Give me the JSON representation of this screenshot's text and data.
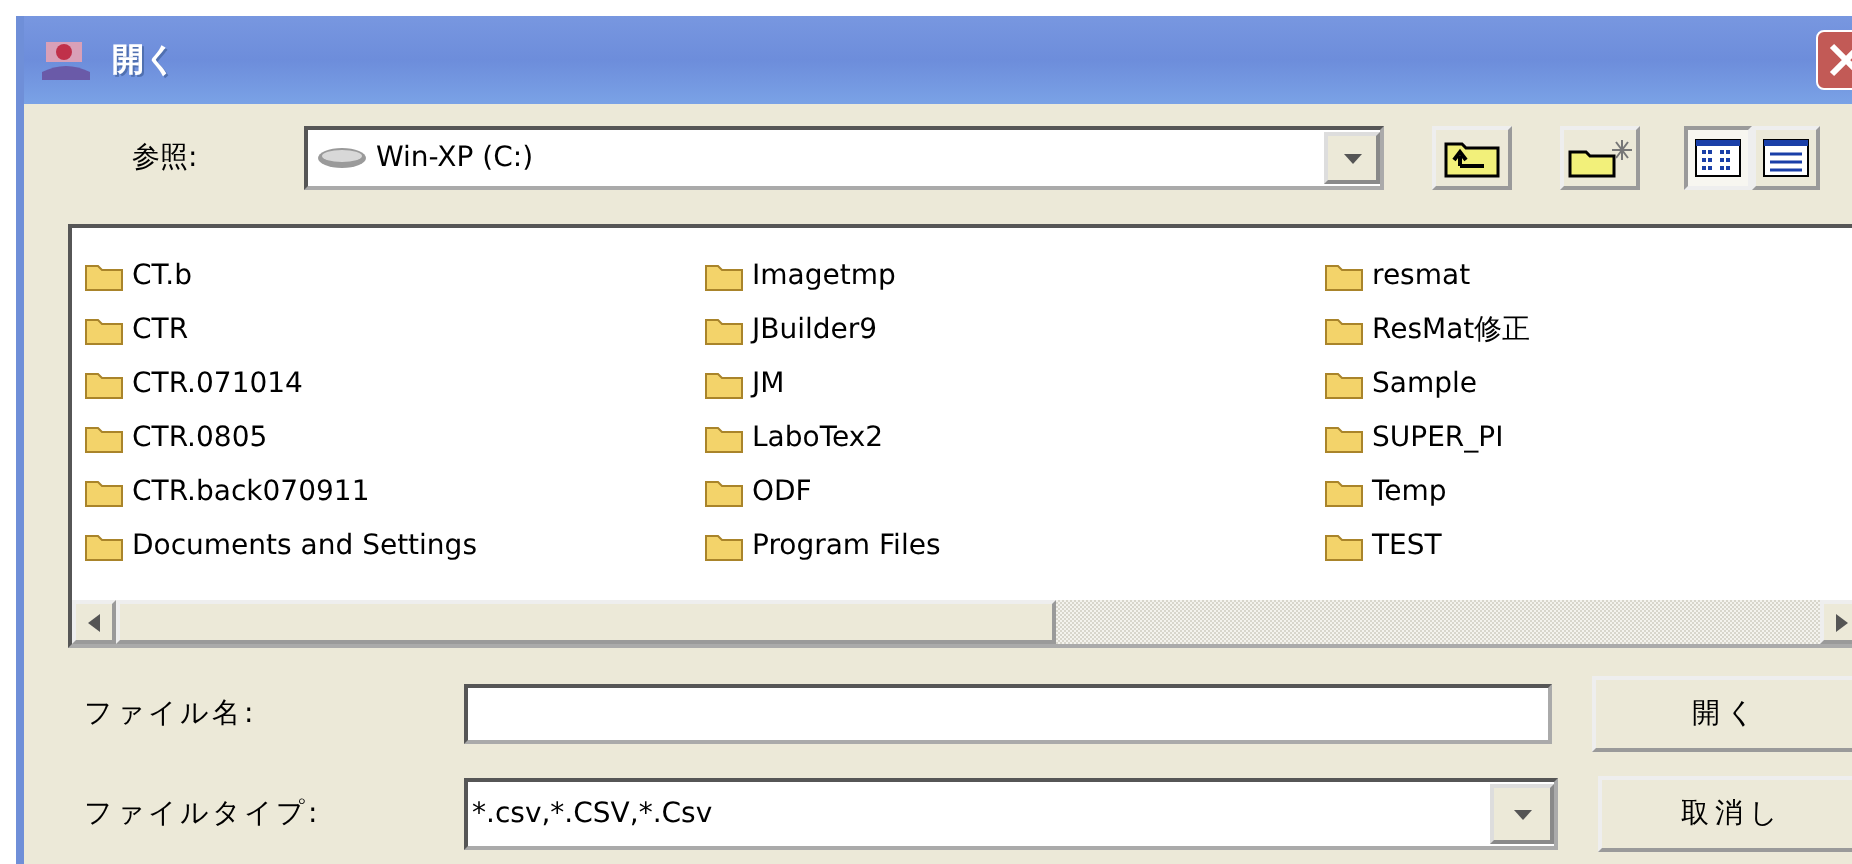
{
  "window": {
    "title": "開く"
  },
  "look_in": {
    "label": "参照:",
    "value": "Win-XP (C:)"
  },
  "view_buttons": [
    {
      "kind": "list",
      "selected": true
    },
    {
      "kind": "details",
      "selected": false
    }
  ],
  "files": [
    {
      "name": "CT.b"
    },
    {
      "name": "CTR"
    },
    {
      "name": "CTR.071014"
    },
    {
      "name": "CTR.0805"
    },
    {
      "name": "CTR.back070911"
    },
    {
      "name": "Documents and Settings"
    },
    {
      "name": "Imagetmp"
    },
    {
      "name": "JBuilder9"
    },
    {
      "name": "JM"
    },
    {
      "name": "LaboTex2"
    },
    {
      "name": "ODF"
    },
    {
      "name": "Program Files"
    },
    {
      "name": "resmat"
    },
    {
      "name": "ResMat修正"
    },
    {
      "name": "Sample"
    },
    {
      "name": "SUPER_PI"
    },
    {
      "name": "Temp"
    },
    {
      "name": "TEST"
    }
  ],
  "file_name": {
    "label": "ファイル名:"
  },
  "file_type": {
    "label": "ファイルタイプ:",
    "value": "*.csv,*.CSV,*.Csv"
  },
  "buttons": [
    "開く",
    "取消し"
  ]
}
